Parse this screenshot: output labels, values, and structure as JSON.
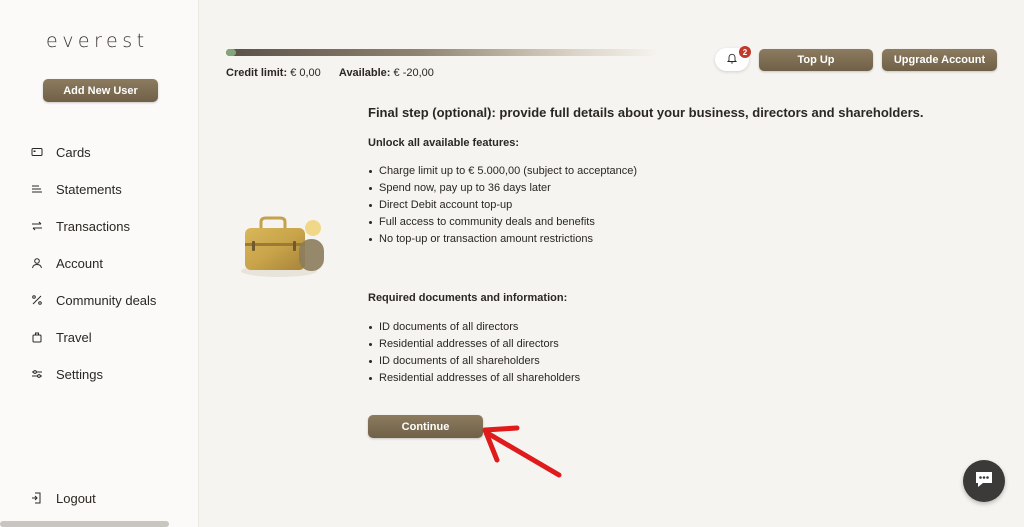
{
  "sidebar": {
    "logo": "everest",
    "add_user_label": "Add New User",
    "items": [
      {
        "label": "Cards",
        "icon": "card-icon"
      },
      {
        "label": "Statements",
        "icon": "statements-icon"
      },
      {
        "label": "Transactions",
        "icon": "transactions-icon"
      },
      {
        "label": "Account",
        "icon": "account-icon"
      },
      {
        "label": "Community deals",
        "icon": "percent-icon"
      },
      {
        "label": "Travel",
        "icon": "travel-icon"
      },
      {
        "label": "Settings",
        "icon": "settings-icon"
      }
    ],
    "logout_label": "Logout"
  },
  "header": {
    "credit_limit_label": "Credit limit:",
    "credit_limit_value": "€ 0,00",
    "available_label": "Available:",
    "available_value": "€ -20,00",
    "notification_count": "2",
    "topup_label": "Top Up",
    "upgrade_label": "Upgrade Account"
  },
  "main": {
    "heading": "Final step (optional): provide full details about your business, directors and shareholders.",
    "features_title": "Unlock all available features:",
    "features": [
      "Charge limit up to € 5.000,00 (subject to acceptance)",
      "Spend now, pay up to 36 days later",
      "Direct Debit account top-up",
      "Full access to community deals and benefits",
      "No top-up or transaction amount restrictions"
    ],
    "documents_title": "Required documents and information:",
    "documents": [
      "ID documents of all directors",
      "Residential addresses of all directors",
      "ID documents of all shareholders",
      "Residential addresses of all shareholders"
    ],
    "continue_label": "Continue"
  },
  "colors": {
    "accent": "#7d6d52",
    "badge": "#c0392b",
    "annotation_arrow": "#e01b1b"
  }
}
